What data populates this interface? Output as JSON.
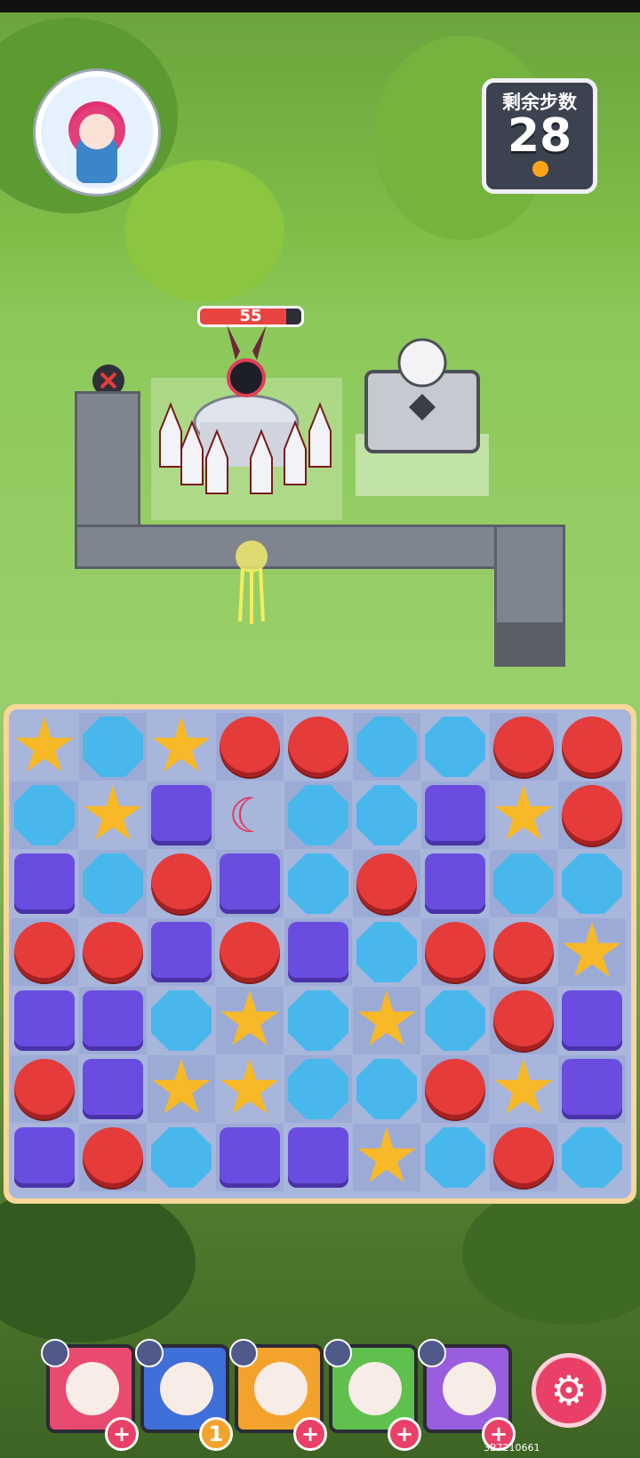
{
  "hud": {
    "moves_label": "剩余步数",
    "moves_value": "28"
  },
  "boss": {
    "hp_value": "55",
    "hp_fraction": 0.85
  },
  "board": {
    "rows": [
      [
        "yellow",
        "blue",
        "yellow",
        "red",
        "red",
        "blue",
        "blue",
        "red",
        "red"
      ],
      [
        "blue",
        "yellow",
        "purple",
        "moon",
        "blue",
        "blue",
        "purple",
        "yellow",
        "red"
      ],
      [
        "purple",
        "blue",
        "red",
        "purple",
        "blue",
        "red",
        "purple",
        "blue",
        "blue"
      ],
      [
        "red",
        "red",
        "purple",
        "red",
        "purple",
        "blue",
        "red",
        "red",
        "yellow"
      ],
      [
        "purple",
        "purple",
        "blue",
        "yellow",
        "blue",
        "yellow",
        "blue",
        "red",
        "purple"
      ],
      [
        "red",
        "purple",
        "yellow",
        "yellow",
        "blue",
        "blue",
        "red",
        "yellow",
        "purple"
      ],
      [
        "purple",
        "red",
        "blue",
        "purple",
        "purple",
        "yellow",
        "blue",
        "red",
        "blue"
      ]
    ]
  },
  "party": [
    {
      "name": "hero-1",
      "color": "#e94a6f",
      "status_icon": "close-icon",
      "action": "+"
    },
    {
      "name": "hero-2",
      "color": "#3f6fd8",
      "status_icon": "swap-icon",
      "action": "1"
    },
    {
      "name": "hero-3",
      "color": "#f3a22b",
      "status_icon": "vertical-swap-icon",
      "action": "+"
    },
    {
      "name": "hero-4",
      "color": "#5fc04e",
      "status_icon": "cycle-icon",
      "action": "+"
    },
    {
      "name": "hero-5",
      "color": "#9a5de0",
      "status_icon": "wand-icon",
      "action": "+"
    }
  ],
  "footer": {
    "code": "3B7210661"
  }
}
